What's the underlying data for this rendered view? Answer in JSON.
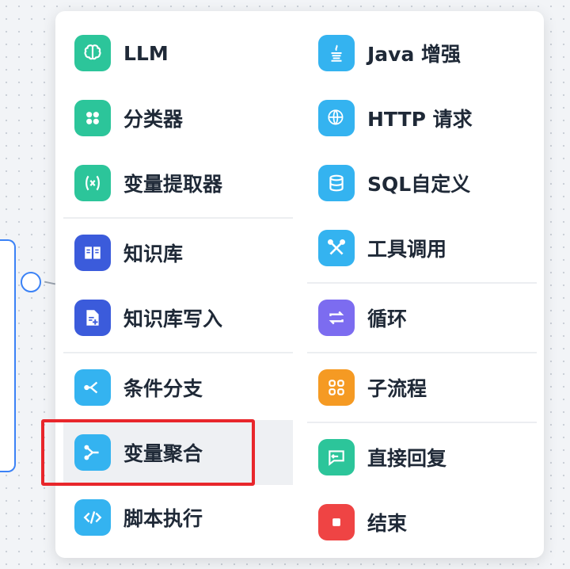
{
  "menu": {
    "left": [
      {
        "label": "LLM",
        "icon": "brain-icon",
        "color": "#2cc59a"
      },
      {
        "label": "分类器",
        "icon": "grid-icon",
        "color": "#2cc59a"
      },
      {
        "label": "变量提取器",
        "icon": "variable-x-icon",
        "color": "#2cc59a"
      },
      {
        "label": "知识库",
        "icon": "book-icon",
        "color": "#3b5bdb"
      },
      {
        "label": "知识库写入",
        "icon": "file-plus-icon",
        "color": "#3b5bdb"
      },
      {
        "label": "条件分支",
        "icon": "branch-icon",
        "color": "#34b3f0"
      },
      {
        "label": "变量聚合",
        "icon": "merge-icon",
        "color": "#34b3f0"
      },
      {
        "label": "脚本执行",
        "icon": "code-icon",
        "color": "#34b3f0"
      }
    ],
    "right": [
      {
        "label": "Java 增强",
        "icon": "java-icon",
        "color": "#34b3f0"
      },
      {
        "label": "HTTP 请求",
        "icon": "globe-http-icon",
        "color": "#34b3f0"
      },
      {
        "label": "SQL自定义",
        "icon": "database-icon",
        "color": "#34b3f0"
      },
      {
        "label": "工具调用",
        "icon": "tools-icon",
        "color": "#34b3f0"
      },
      {
        "label": "循环",
        "icon": "loop-icon",
        "color": "#7c6cf0"
      },
      {
        "label": "子流程",
        "icon": "subflow-icon",
        "color": "#f59a23"
      },
      {
        "label": "直接回复",
        "icon": "reply-icon",
        "color": "#2cc59a"
      },
      {
        "label": "结束",
        "icon": "stop-icon",
        "color": "#ef4444"
      }
    ]
  },
  "highlight_color": "#e8262b"
}
